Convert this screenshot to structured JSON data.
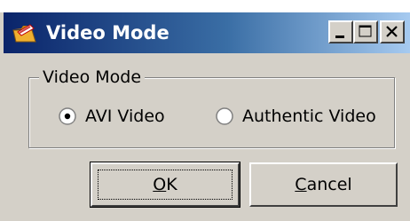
{
  "window": {
    "title": "Video Mode",
    "icons": {
      "app": "folder-icon",
      "minimize": "minimize-icon",
      "maximize": "maximize-icon",
      "close": "close-icon"
    }
  },
  "group": {
    "label": "Video Mode",
    "options": [
      {
        "label": "AVI Video",
        "selected": true
      },
      {
        "label": "Authentic Video",
        "selected": false
      }
    ]
  },
  "buttons": {
    "ok": {
      "label": "OK",
      "mnemonic": "O"
    },
    "cancel": {
      "label": "Cancel",
      "mnemonic": "C"
    }
  },
  "colors": {
    "face": "#d4d0c8",
    "title_start": "#0a246a",
    "title_end": "#a6caf0"
  }
}
